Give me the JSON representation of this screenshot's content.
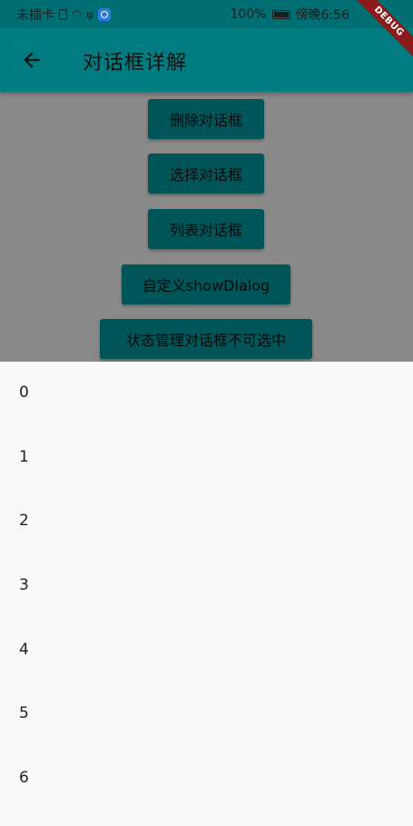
{
  "status_bar": {
    "carrier": "未插卡",
    "battery": "100%",
    "time": "傍晚6:56"
  },
  "app_bar": {
    "back_icon": "arrow-left-icon",
    "title": "对话框详解",
    "debug_banner": "DEBUG"
  },
  "buttons": [
    {
      "label": "删除对话框"
    },
    {
      "label": "选择对话框"
    },
    {
      "label": "列表对话框"
    },
    {
      "label": "自定义showDialog"
    },
    {
      "label": "状态管理对话框不可选中"
    }
  ],
  "sheet": {
    "items": [
      "0",
      "1",
      "2",
      "3",
      "4",
      "5",
      "6"
    ]
  },
  "colors": {
    "primary": "#007b80",
    "button": "#009ca3",
    "sheet_background": "#f9f9f9"
  }
}
